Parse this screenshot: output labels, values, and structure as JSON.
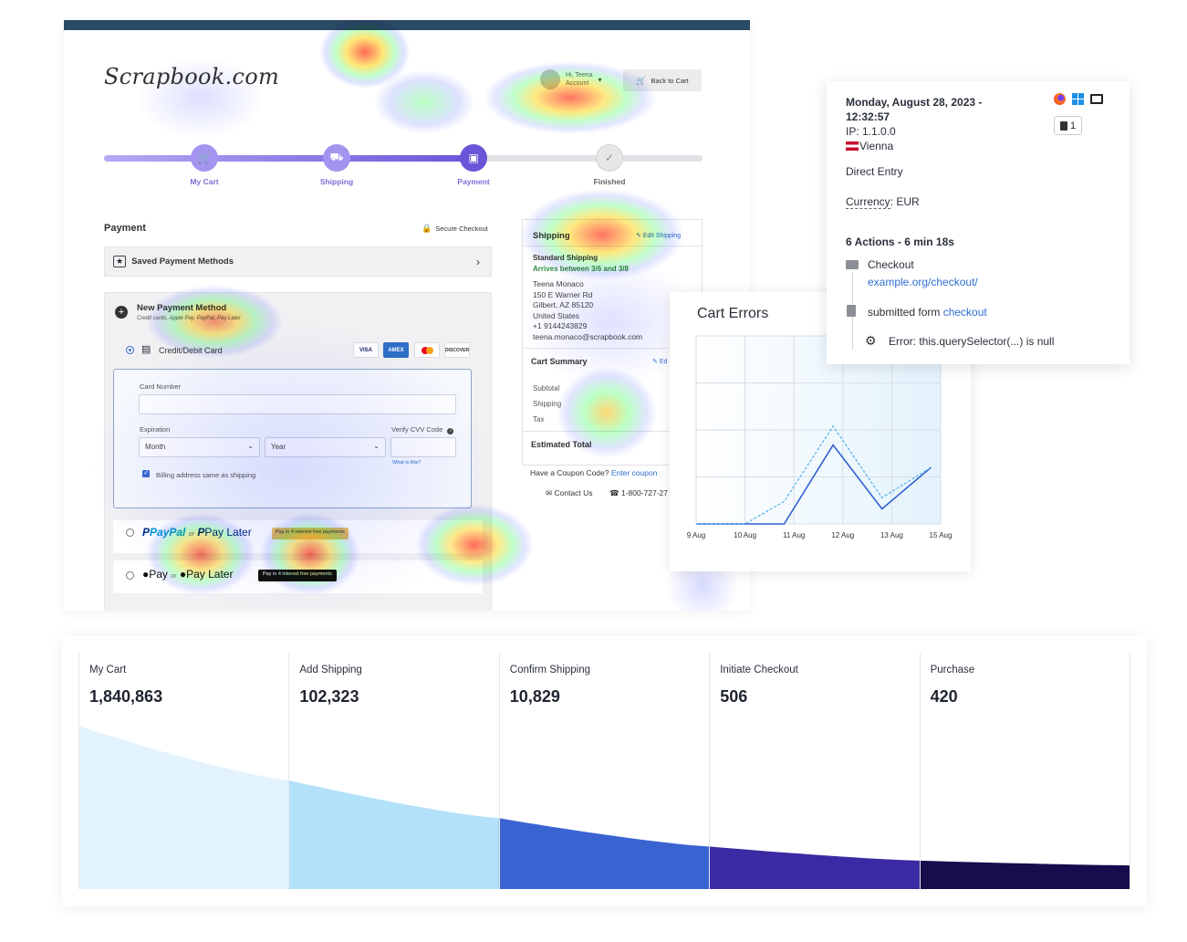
{
  "checkout": {
    "logo": "Scrapbook.com",
    "account_greeting": "Hi, Teena",
    "account_label": "Account",
    "back_to_cart": "Back to Cart",
    "steps": [
      {
        "label": "My Cart",
        "icon": "cart-icon",
        "state": "done"
      },
      {
        "label": "Shipping",
        "icon": "truck-icon",
        "state": "done"
      },
      {
        "label": "Payment",
        "icon": "credit-card-icon",
        "state": "current"
      },
      {
        "label": "Finished",
        "icon": "check-icon",
        "state": "pending"
      }
    ],
    "payment_heading": "Payment",
    "secure_checkout": "Secure Checkout",
    "saved_methods": "Saved Payment Methods",
    "new_method_title": "New Payment Method",
    "new_method_sub": "Credit cards, Apple Pay, PayPal, Pay Later",
    "credit_debit": "Credit/Debit Card",
    "card_brands": [
      "VISA",
      "AMEX",
      "MC",
      "DISCOVER"
    ],
    "card_number_label": "Card Number",
    "expiration_label": "Expiration",
    "month_placeholder": "Month",
    "year_placeholder": "Year",
    "cvv_label": "Verify CVV Code",
    "what_is_this": "What is this?",
    "billing_same": "Billing address same as shipping",
    "paypal": "PayPal",
    "or": "or",
    "pay_later": "Pay Later",
    "paypal_badge": "Pay in 4 interest free payments",
    "apple_pay": "Pay",
    "apple_pay_later": "Pay Later",
    "apple_badge": "Pay in 4 interest free payments",
    "shipping_heading": "Shipping",
    "edit_shipping": "Edit Shipping",
    "shipping_method": "Standard Shipping",
    "arrives": "Arrives between 3/6 and 3/8",
    "address": [
      "Teena Monaco",
      "150 E Warner Rd",
      "Gilbert, AZ 85120",
      "United States",
      "+1 9144243829",
      "teena.monaco@scrapbook.com"
    ],
    "cart_summary": "Cart Summary",
    "cart_summary_edit": "Ed",
    "subtotal": "Subtotal",
    "shipping": "Shipping",
    "tax": "Tax",
    "estimated_total": "Estimated Total",
    "coupon_q": "Have a Coupon Code?",
    "coupon_link": "Enter coupon",
    "contact_us": "Contact Us",
    "phone": "1-800-727-27"
  },
  "cart_errors": {
    "title": "Cart Errors"
  },
  "chart_data": {
    "type": "line",
    "title": "Cart Errors",
    "categories": [
      "9 Aug",
      "10 Aug",
      "11 Aug",
      "12 Aug",
      "13 Aug",
      "15 Aug"
    ],
    "x_positions": [
      0,
      1,
      2,
      3,
      4,
      5
    ],
    "series": [
      {
        "style": "solid",
        "color": "#2f5fd0",
        "x": [
          0,
          1,
          1.8,
          2.8,
          3.8,
          4.8
        ],
        "values": [
          0,
          0,
          0,
          4.2,
          0.8,
          3.0
        ]
      },
      {
        "style": "dashed",
        "color": "#4fb0e8",
        "x": [
          0,
          1,
          1.8,
          2.8,
          3.8,
          4.8
        ],
        "values": [
          0,
          0,
          1.2,
          5.2,
          1.4,
          3.0
        ]
      }
    ],
    "ylim": [
      0,
      10
    ],
    "grid": true
  },
  "session": {
    "datetime_line1": "Monday, August 28, 2023 -",
    "datetime_line2": "12:32:57",
    "ip": "IP: 1.1.0.0",
    "city": "Vienna",
    "source": "Direct Entry",
    "currency_label": "Currency",
    "currency_value": ": EUR",
    "page_count": "1",
    "actions_heading": "6 Actions - 6 min 18s",
    "events": [
      {
        "icon": "folder-icon",
        "text": "Checkout",
        "link": "example.org/checkout/"
      },
      {
        "icon": "clipboard-icon",
        "text": "submitted form",
        "link": "checkout"
      },
      {
        "icon": "bug-icon",
        "text": "Error: this.querySelector(...) is null",
        "link": ""
      }
    ],
    "browser_icons": [
      "firefox-icon",
      "windows-icon",
      "desktop-icon"
    ],
    "colors": {
      "flag_red": "#c8102e"
    }
  },
  "funnel": {
    "stages": [
      {
        "label": "My Cart",
        "value": "1,840,863",
        "color": "#e3f3fd"
      },
      {
        "label": "Add Shipping",
        "value": "102,323",
        "color": "#b3e1fa"
      },
      {
        "label": "Confirm Shipping",
        "value": "10,829",
        "color": "#3a63d2"
      },
      {
        "label": "Initiate Checkout",
        "value": "506",
        "color": "#3a2aa3"
      },
      {
        "label": "Purchase",
        "value": "420",
        "color": "#150d4d"
      }
    ]
  }
}
